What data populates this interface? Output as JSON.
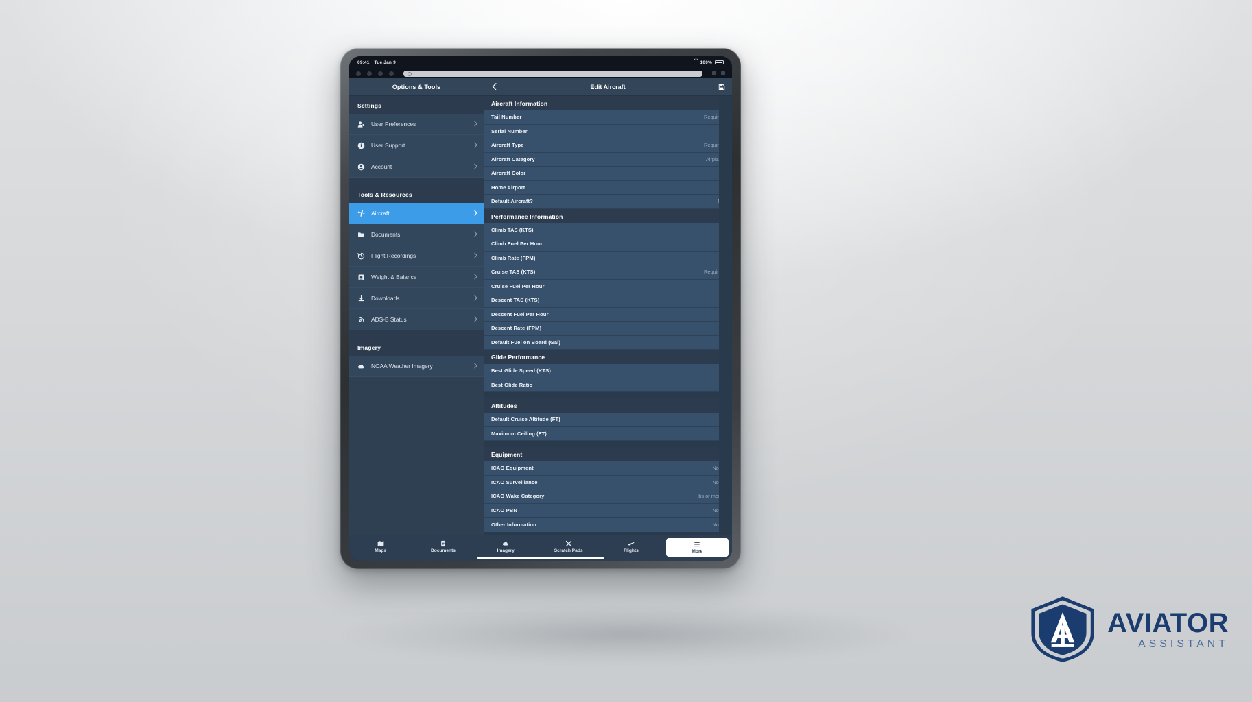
{
  "status_bar": {
    "time": "09:41",
    "date": "Tue Jan 9",
    "battery": "100%",
    "wifi_icon": "wifi-icon",
    "battery_icon": "battery-icon"
  },
  "navbar": {
    "left_title": "Options & Tools",
    "back_icon": "chevron-left-icon",
    "title": "Edit Aircraft",
    "save_icon": "save-icon"
  },
  "sidebar": {
    "sections": [
      {
        "header": "Settings",
        "items": [
          {
            "label": "User Preferences",
            "icon": "user-preferences-icon",
            "chevron": "chevron-right-icon",
            "active": false
          },
          {
            "label": "User Support",
            "icon": "info-circle-icon",
            "chevron": "chevron-right-icon",
            "active": false
          },
          {
            "label": "Account",
            "icon": "account-circle-icon",
            "chevron": "chevron-right-icon",
            "active": false
          }
        ]
      },
      {
        "header": "Tools & Resources",
        "items": [
          {
            "label": "Aircraft",
            "icon": "airplane-icon",
            "chevron": "chevron-right-icon",
            "active": true
          },
          {
            "label": "Documents",
            "icon": "folder-icon",
            "chevron": "chevron-right-icon",
            "active": false
          },
          {
            "label": "Flight Recordings",
            "icon": "history-clock-icon",
            "chevron": "chevron-right-icon",
            "active": false
          },
          {
            "label": "Weight & Balance",
            "icon": "scale-icon",
            "chevron": "chevron-right-icon",
            "active": false
          },
          {
            "label": "Downloads",
            "icon": "download-icon",
            "chevron": "chevron-right-icon",
            "active": false
          },
          {
            "label": "ADS-B Status",
            "icon": "broadcast-icon",
            "chevron": "chevron-right-icon",
            "active": false
          }
        ]
      },
      {
        "header": "Imagery",
        "items": [
          {
            "label": "NOAA Weather Imagery",
            "icon": "cloud-icon",
            "chevron": "chevron-right-icon",
            "active": false
          }
        ]
      }
    ]
  },
  "detail": {
    "sections": [
      {
        "header": "Aircraft Information",
        "rows": [
          {
            "label": "Tail Number",
            "value": "Required"
          },
          {
            "label": "Serial Number",
            "value": ""
          },
          {
            "label": "Aircraft Type",
            "value": "Required"
          },
          {
            "label": "Aircraft Category",
            "value": "Airplane"
          },
          {
            "label": "Aircraft Color",
            "value": ""
          },
          {
            "label": "Home Airport",
            "value": ""
          },
          {
            "label": "Default Aircraft?",
            "value": "No"
          }
        ]
      },
      {
        "header": "Performance Information",
        "rows": [
          {
            "label": "Climb TAS (KTS)",
            "value": ""
          },
          {
            "label": "Climb Fuel Per Hour",
            "value": ""
          },
          {
            "label": "Climb Rate (FPM)",
            "value": ""
          },
          {
            "label": "Cruise TAS (KTS)",
            "value": "Required"
          },
          {
            "label": "Cruise Fuel Per Hour",
            "value": ""
          },
          {
            "label": "Descent TAS (KTS)",
            "value": ""
          },
          {
            "label": "Descent Fuel Per Hour",
            "value": ""
          },
          {
            "label": "Descent Rate (FPM)",
            "value": ""
          },
          {
            "label": "Default Fuel on Board (Gal)",
            "value": ""
          }
        ]
      },
      {
        "header": "Glide Performance",
        "rows": [
          {
            "label": "Best Glide Speed (KTS)",
            "value": ""
          },
          {
            "label": "Best Glide Ratio",
            "value": ""
          }
        ]
      },
      {
        "header": "Altitudes",
        "rows": [
          {
            "label": "Default Cruise Altitude (FT)",
            "value": ""
          },
          {
            "label": "Maximum Ceiling (FT)",
            "value": ""
          }
        ]
      },
      {
        "header": "Equipment",
        "rows": [
          {
            "label": "ICAO Equipment",
            "value": "None"
          },
          {
            "label": "ICAO Surveillance",
            "value": "None"
          },
          {
            "label": "ICAO Wake Category",
            "value": "lbs or more)"
          },
          {
            "label": "ICAO PBN",
            "value": "None"
          },
          {
            "label": "Other Information",
            "value": "None"
          }
        ]
      }
    ]
  },
  "tabbar": {
    "tabs": [
      {
        "label": "Maps",
        "icon": "map-icon",
        "selected": false
      },
      {
        "label": "Documents",
        "icon": "document-icon",
        "selected": false
      },
      {
        "label": "Imagery",
        "icon": "imagery-cloud-icon",
        "selected": false
      },
      {
        "label": "Scratch Pads",
        "icon": "scratch-pad-icon",
        "selected": false
      },
      {
        "label": "Flights",
        "icon": "flights-icon",
        "selected": false
      },
      {
        "label": "More",
        "icon": "more-list-icon",
        "selected": true
      }
    ]
  },
  "branding": {
    "name": "AVIATOR",
    "tagline": "ASSISTANT",
    "mark_icon": "aviator-shield-logo",
    "brand_color": "#1b3c6e",
    "accent_color": "#3d9ce8"
  }
}
